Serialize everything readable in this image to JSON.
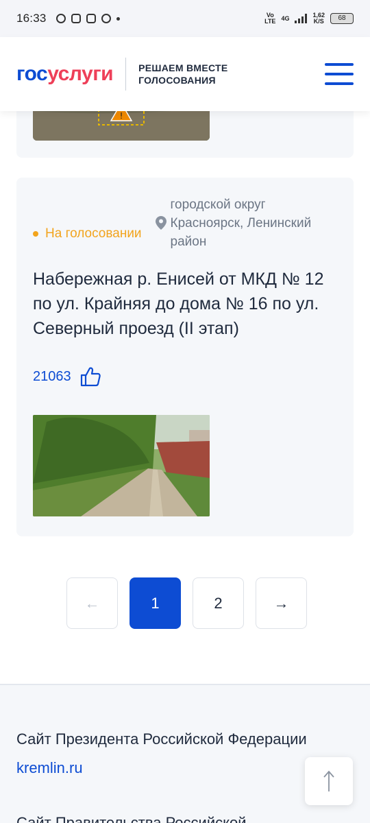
{
  "status_bar": {
    "time": "16:33",
    "net_top": "Vo",
    "net_bottom": "LTE",
    "signal_label": "4G",
    "speed_value": "1,62",
    "speed_unit": "K/S",
    "battery": "68"
  },
  "header": {
    "logo_part1": "гос",
    "logo_part2": "услуги",
    "tagline_line1": "РЕШАЕМ ВМЕСТЕ",
    "tagline_line2": "ГОЛОСОВАНИЯ"
  },
  "project": {
    "status": "На голосовании",
    "location": "городской округ Красноярск, Ленинский район",
    "title": "Набережная р. Енисей от МКД № 12 по ул. Крайняя до дома № 16 по ул. Северный проезд (II этап)",
    "votes": "21063"
  },
  "pagination": {
    "prev": "←",
    "pages": [
      "1",
      "2"
    ],
    "next": "→",
    "current": "1"
  },
  "footer": {
    "title": "Сайт Президента Российской Федерации",
    "link": "kremlin.ru",
    "title2": "Сайт Правительства Российской"
  },
  "icons": {
    "menu": "burger-icon",
    "pin": "location-pin-icon",
    "like": "thumbs-up-icon",
    "up": "arrow-up-icon"
  },
  "colors": {
    "brand_blue": "#0d4cd3",
    "brand_red": "#ee3f58",
    "status_orange": "#f2a41d"
  }
}
